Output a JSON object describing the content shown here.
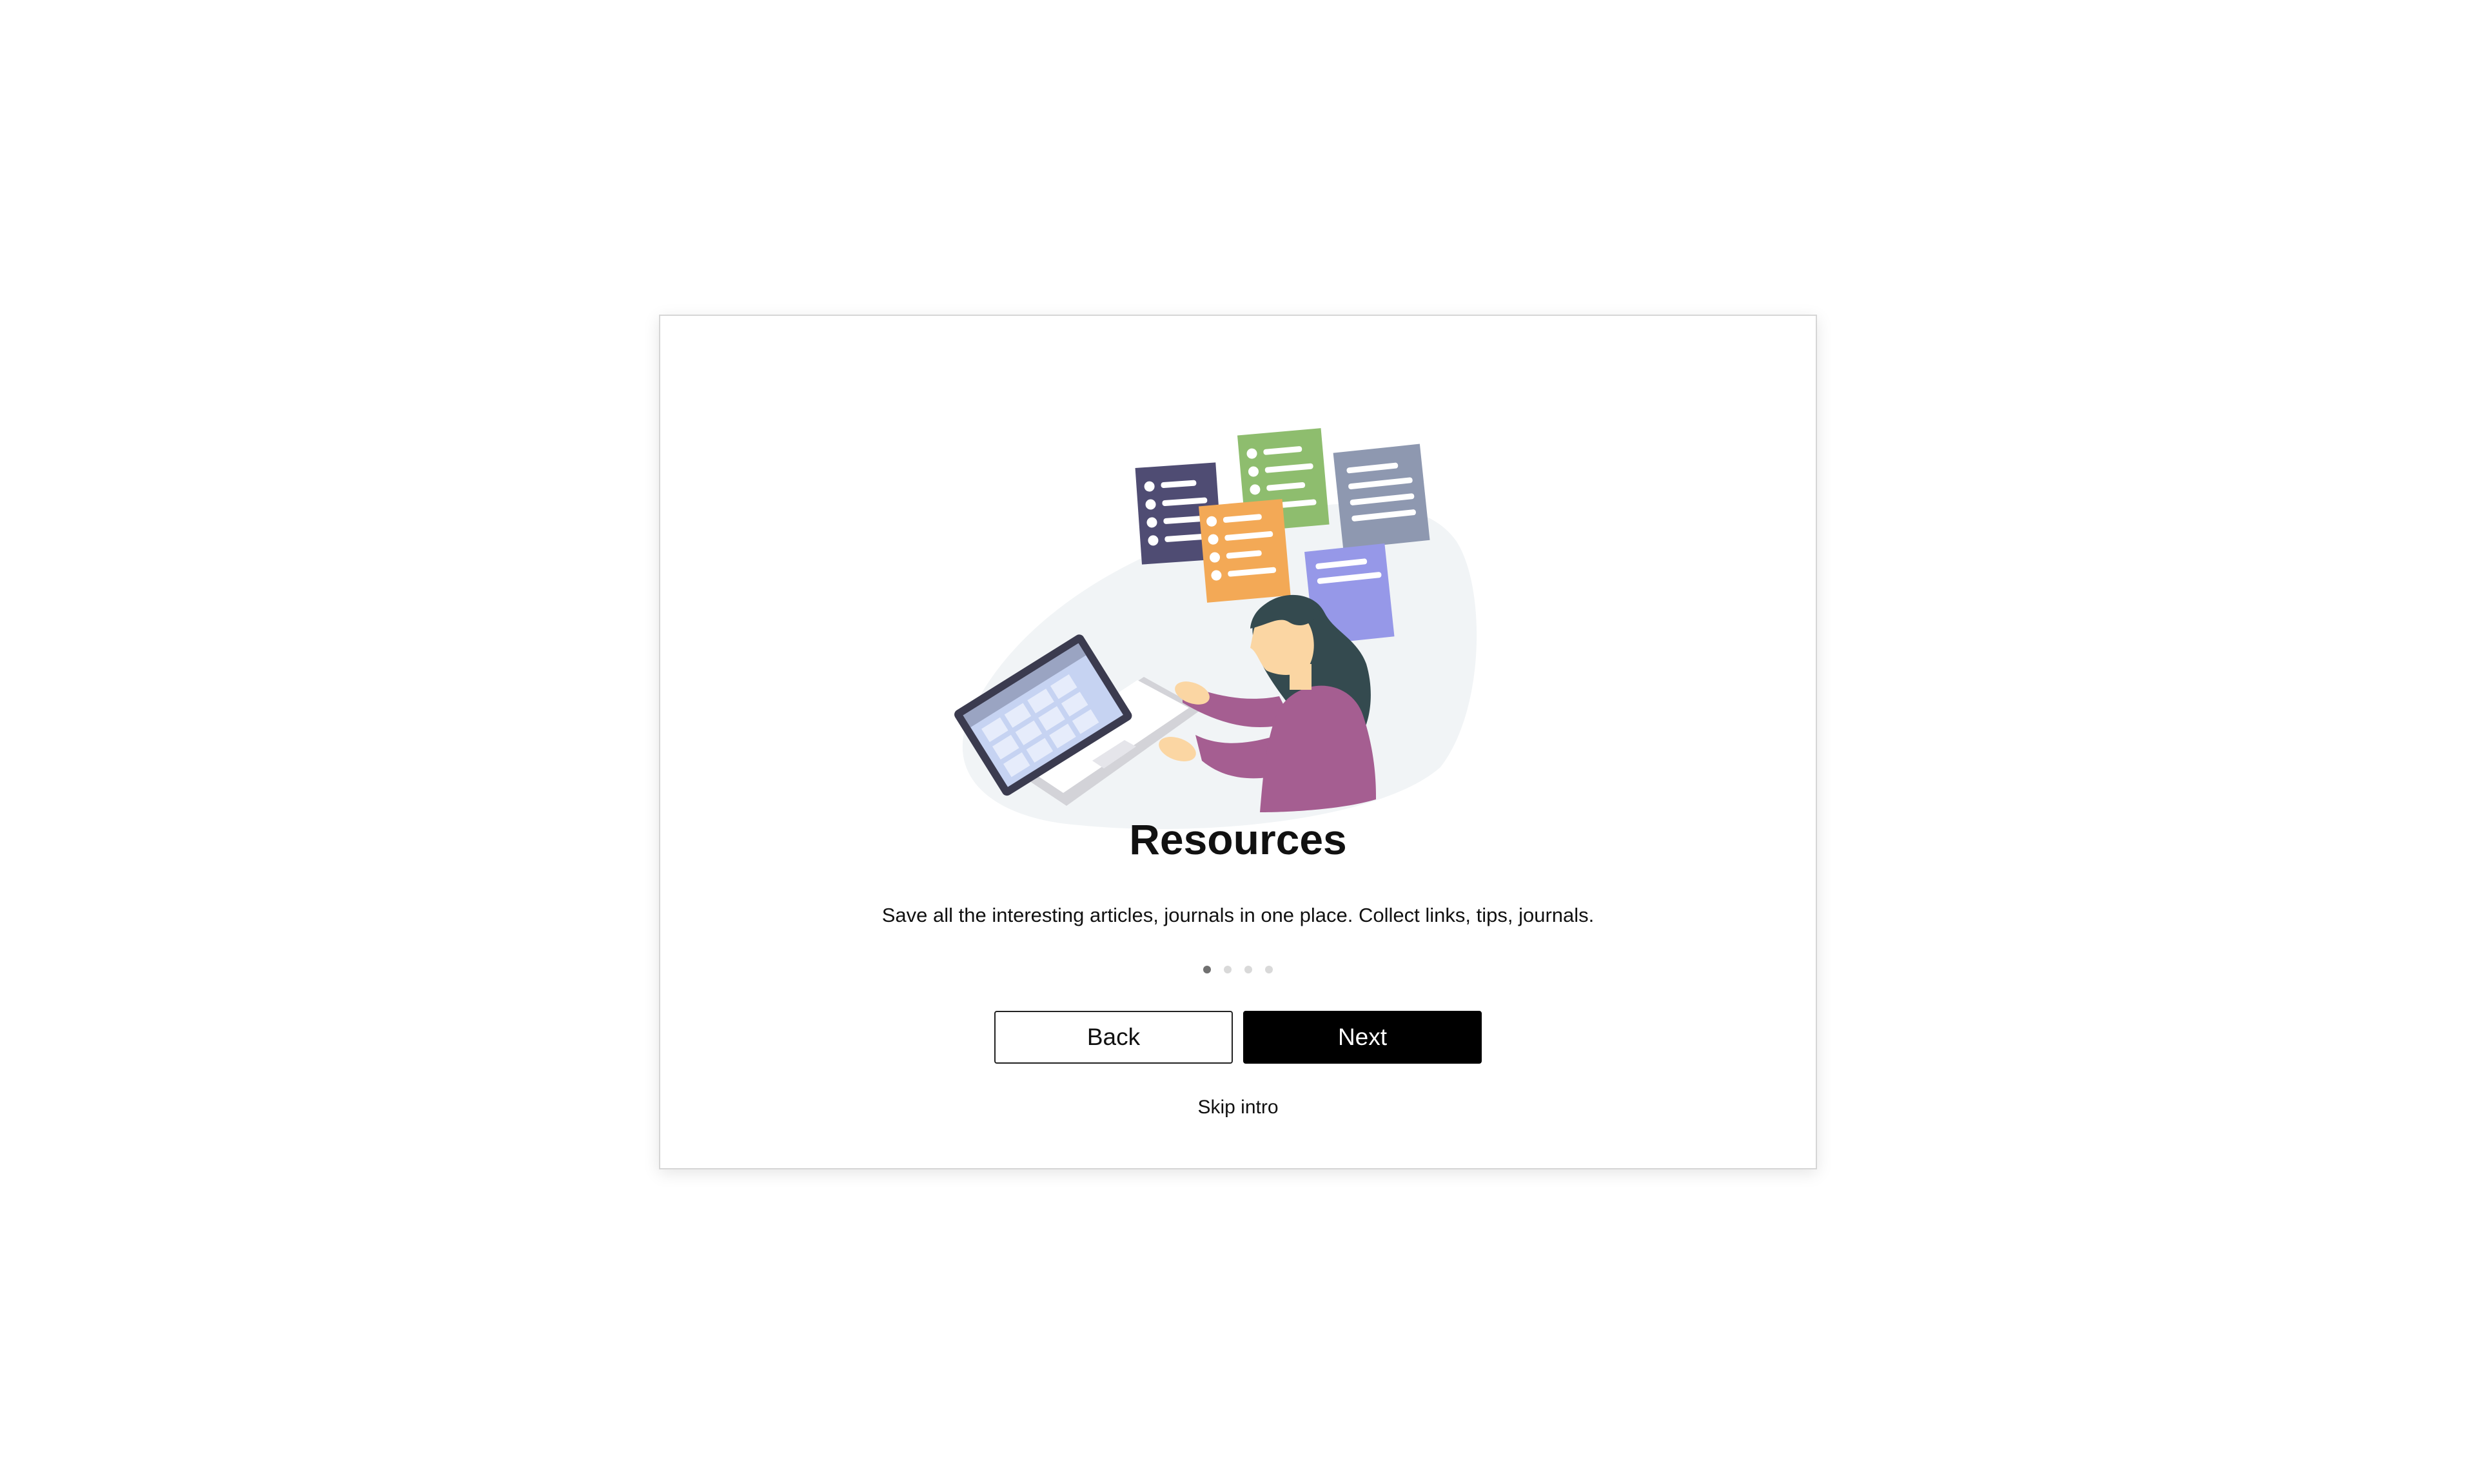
{
  "onboarding": {
    "title": "Resources",
    "description": "Save all the interesting articles, journals in one place. Collect links, tips, journals.",
    "steps_total": 4,
    "step_current": 1,
    "back_label": "Back",
    "next_label": "Next",
    "skip_label": "Skip intro"
  },
  "colors": {
    "primary_button": "#000000",
    "doc_navy": "#4f4c73",
    "doc_green": "#8ebd6e",
    "doc_gray": "#8e98b0",
    "doc_orange": "#f3a956",
    "doc_purple": "#9698e8",
    "sweater": "#a55e91",
    "hair": "#344a4f",
    "blob": "#f1f4f6"
  },
  "icons": [
    "resources-illustration",
    "document-icon",
    "laptop-icon",
    "person-illustration"
  ]
}
